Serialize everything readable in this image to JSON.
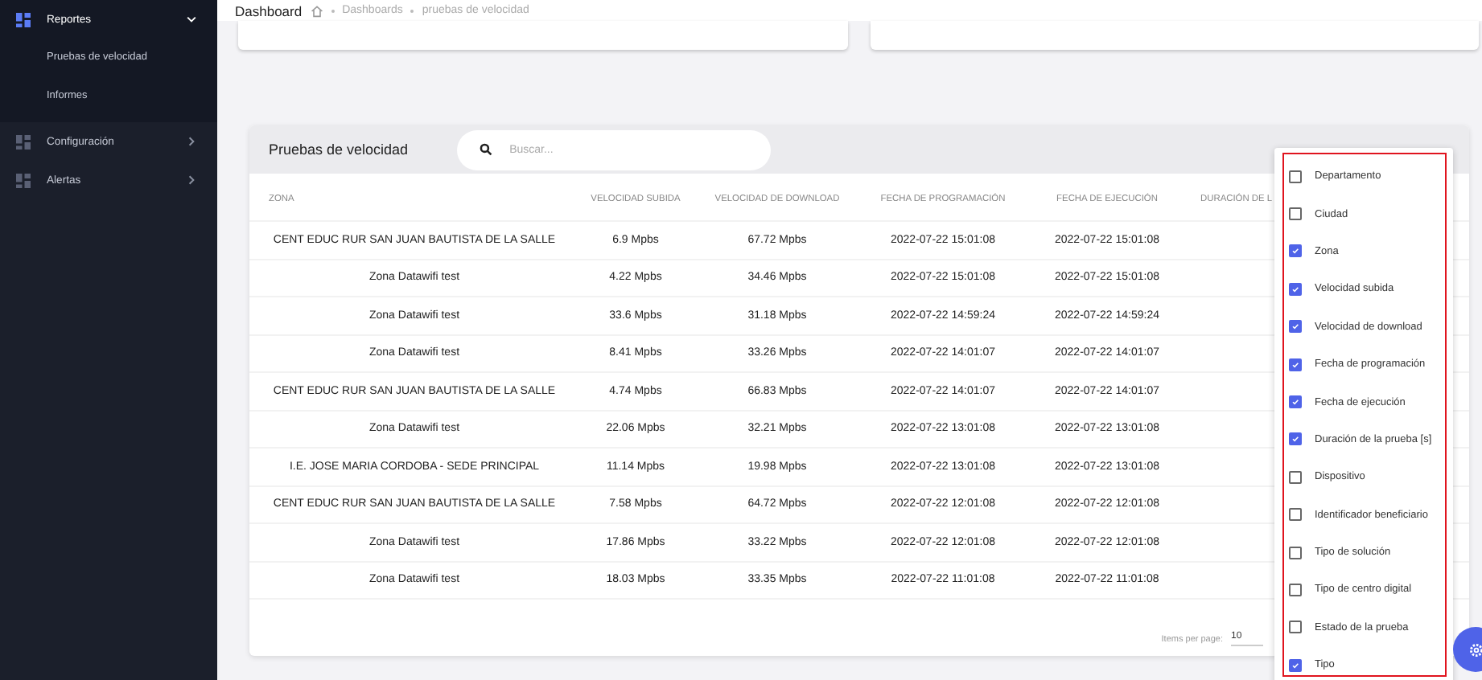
{
  "sidebar": {
    "items": [
      {
        "label": "Reportes",
        "expanded": true,
        "selected": true,
        "children": [
          {
            "label": "Pruebas de velocidad"
          },
          {
            "label": "Informes"
          }
        ]
      },
      {
        "label": "Configuración",
        "expanded": false,
        "selected": false
      },
      {
        "label": "Alertas",
        "expanded": false,
        "selected": false
      }
    ]
  },
  "header": {
    "title": "Dashboard",
    "breadcrumbs": [
      "Dashboards",
      "pruebas de velocidad"
    ]
  },
  "panel": {
    "title": "Pruebas de velocidad",
    "search": {
      "placeholder": "Buscar..."
    }
  },
  "table": {
    "columns": [
      "ZONA",
      "VELOCIDAD SUBIDA",
      "VELOCIDAD DE DOWNLOAD",
      "FECHA DE PROGRAMACIÓN",
      "FECHA DE EJECUCIÓN",
      "DURACIÓN DE L"
    ],
    "rows": [
      [
        "CENT EDUC RUR SAN JUAN BAUTISTA DE LA SALLE",
        "6.9 Mpbs",
        "67.72 Mpbs",
        "2022-07-22 15:01:08",
        "2022-07-22 15:01:08"
      ],
      [
        "Zona Datawifi test",
        "4.22 Mpbs",
        "34.46 Mpbs",
        "2022-07-22 15:01:08",
        "2022-07-22 15:01:08"
      ],
      [
        "Zona Datawifi test",
        "33.6 Mpbs",
        "31.18 Mpbs",
        "2022-07-22 14:59:24",
        "2022-07-22 14:59:24"
      ],
      [
        "Zona Datawifi test",
        "8.41 Mpbs",
        "33.26 Mpbs",
        "2022-07-22 14:01:07",
        "2022-07-22 14:01:07"
      ],
      [
        "CENT EDUC RUR SAN JUAN BAUTISTA DE LA SALLE",
        "4.74 Mpbs",
        "66.83 Mpbs",
        "2022-07-22 14:01:07",
        "2022-07-22 14:01:07"
      ],
      [
        "Zona Datawifi test",
        "22.06 Mpbs",
        "32.21 Mpbs",
        "2022-07-22 13:01:08",
        "2022-07-22 13:01:08"
      ],
      [
        "I.E. JOSE MARIA CORDOBA - SEDE PRINCIPAL",
        "11.14 Mpbs",
        "19.98 Mpbs",
        "2022-07-22 13:01:08",
        "2022-07-22 13:01:08"
      ],
      [
        "CENT EDUC RUR SAN JUAN BAUTISTA DE LA SALLE",
        "7.58 Mpbs",
        "64.72 Mpbs",
        "2022-07-22 12:01:08",
        "2022-07-22 12:01:08"
      ],
      [
        "Zona Datawifi test",
        "17.86 Mpbs",
        "33.22 Mpbs",
        "2022-07-22 12:01:08",
        "2022-07-22 12:01:08"
      ],
      [
        "Zona Datawifi test",
        "18.03 Mpbs",
        "33.35 Mpbs",
        "2022-07-22 11:01:08",
        "2022-07-22 11:01:08"
      ]
    ],
    "pagination": {
      "label": "Items per page:",
      "value": "10"
    }
  },
  "column_menu": {
    "options": [
      {
        "label": "Departamento",
        "checked": false
      },
      {
        "label": "Ciudad",
        "checked": false
      },
      {
        "label": "Zona",
        "checked": true
      },
      {
        "label": "Velocidad subida",
        "checked": true
      },
      {
        "label": "Velocidad de download",
        "checked": true
      },
      {
        "label": "Fecha de programación",
        "checked": true
      },
      {
        "label": "Fecha de ejecución",
        "checked": true
      },
      {
        "label": "Duración de la prueba [s]",
        "checked": true
      },
      {
        "label": "Dispositivo",
        "checked": false
      },
      {
        "label": "Identificador beneficiario",
        "checked": false
      },
      {
        "label": "Tipo de solución",
        "checked": false
      },
      {
        "label": "Tipo de centro digital",
        "checked": false
      },
      {
        "label": "Estado de la prueba",
        "checked": false
      },
      {
        "label": "Tipo",
        "checked": true
      }
    ]
  }
}
